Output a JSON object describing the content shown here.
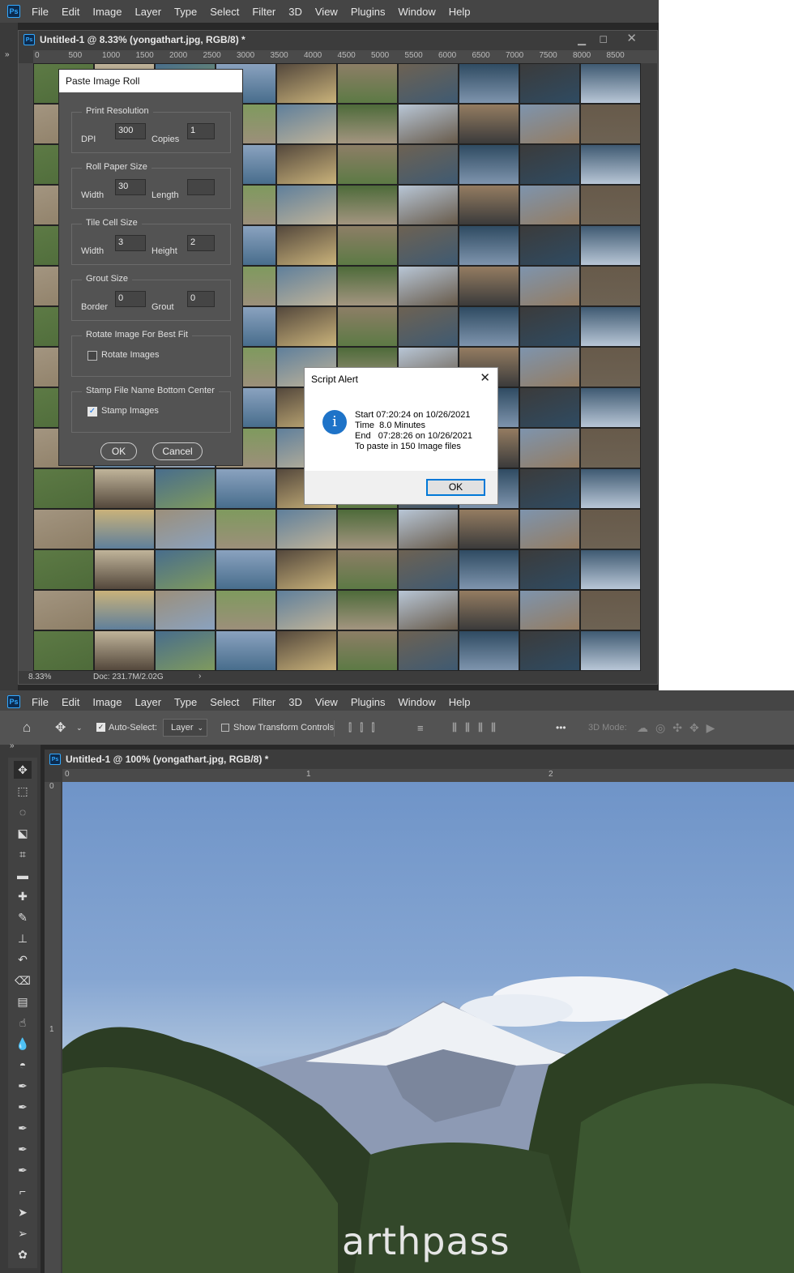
{
  "top": {
    "menu": {
      "logo": "Ps",
      "items": [
        "File",
        "Edit",
        "Image",
        "Layer",
        "Type",
        "Select",
        "Filter",
        "3D",
        "View",
        "Plugins",
        "Window",
        "Help"
      ]
    },
    "doc_tab": {
      "icon": "Ps",
      "title": "Untitled-1 @ 8.33% (yongathart.jpg, RGB/8) *",
      "min_icon": "minimize-icon",
      "max_icon": "maximize-icon",
      "close_icon": "close-icon"
    },
    "ruler_top": [
      "0",
      "500",
      "1000",
      "1500",
      "2000",
      "2500",
      "3000",
      "3500",
      "4000",
      "4500",
      "5000",
      "5500",
      "6000",
      "6500",
      "7000",
      "7500",
      "8000",
      "8500"
    ],
    "status": {
      "zoom": "8.33%",
      "doc": "Doc: 231.7M/2.02G"
    },
    "paste_dialog": {
      "title": "Paste Image Roll",
      "print_resolution": {
        "label": "Print Resolution",
        "dpi_label": "DPI",
        "dpi": "300",
        "copies_label": "Copies",
        "copies": "1"
      },
      "roll_paper": {
        "label": "Roll Paper Size",
        "width_label": "Width",
        "width": "30",
        "length_label": "Length",
        "length": ""
      },
      "tile_cell": {
        "label": "Tile Cell Size",
        "width_label": "Width",
        "width": "3",
        "height_label": "Height",
        "height": "2"
      },
      "grout": {
        "label": "Grout Size",
        "border_label": "Border",
        "border": "0",
        "grout_label": "Grout",
        "grout": "0"
      },
      "rotate": {
        "label": "Rotate Image For Best Fit",
        "checkbox_label": "Rotate Images",
        "checked": false
      },
      "stamp": {
        "label": "Stamp File Name Bottom Center",
        "checkbox_label": "Stamp Images",
        "checked": true
      },
      "ok": "OK",
      "cancel": "Cancel"
    },
    "script_alert": {
      "title": "Script Alert",
      "line1": "Start 07:20:24 on 10/26/2021",
      "line2": "Time  8.0 Minutes",
      "line3": "End   07:28:26 on 10/26/2021",
      "line4": "To paste in 150 Image files",
      "ok": "OK",
      "info_icon": "i"
    }
  },
  "bottom": {
    "menu": {
      "logo": "Ps",
      "items": [
        "File",
        "Edit",
        "Image",
        "Layer",
        "Type",
        "Select",
        "Filter",
        "3D",
        "View",
        "Plugins",
        "Window",
        "Help"
      ]
    },
    "options": {
      "auto_select_label": "Auto-Select:",
      "auto_select_checked": true,
      "layer_select": "Layer",
      "show_transform": "Show Transform Controls",
      "mode_3d": "3D Mode:",
      "more": "•••"
    },
    "doc_tab": {
      "icon": "Ps",
      "title": "Untitled-1 @ 100% (yongathart.jpg, RGB/8) *"
    },
    "ruler_top": [
      "0",
      "1",
      "2"
    ],
    "ruler_left": [
      "0",
      "1"
    ],
    "photo_caption": "arthpass"
  },
  "colors": {
    "accent": "#31a8ff",
    "panel": "#535353",
    "menubar": "#454545",
    "workspace": "#282828"
  }
}
